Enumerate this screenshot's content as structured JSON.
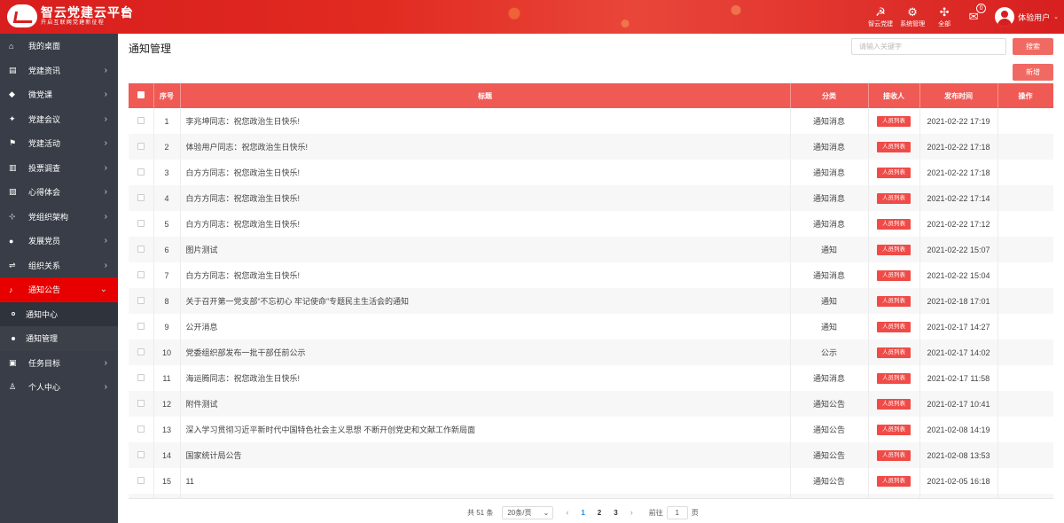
{
  "app": {
    "title": "智云党建云平台",
    "subtitle": "开启互联网党建新征程",
    "menu_toggle": "☰"
  },
  "header": {
    "tools": [
      {
        "icon": "party-icon",
        "glyph": "☭",
        "label": "智云党建"
      },
      {
        "icon": "gear-icon",
        "glyph": "⚙",
        "label": "系统管理"
      },
      {
        "icon": "grid-icon",
        "glyph": "✣",
        "label": "全部"
      }
    ],
    "mail_count": "0",
    "user_name": "体验用户",
    "user_caret": "⌄"
  },
  "sidebar": {
    "items": [
      {
        "icon": "home-icon",
        "glyph": "⌂",
        "label": "我的桌面",
        "chevron": ""
      },
      {
        "icon": "news-icon",
        "glyph": "▤",
        "label": "党建资讯",
        "chevron": "›"
      },
      {
        "icon": "course-icon",
        "glyph": "◆",
        "label": "微党课",
        "chevron": "›"
      },
      {
        "icon": "meeting-icon",
        "glyph": "✦",
        "label": "党建会议",
        "chevron": "›"
      },
      {
        "icon": "flag-icon",
        "glyph": "⚑",
        "label": "党建活动",
        "chevron": "›"
      },
      {
        "icon": "chart-icon",
        "glyph": "▥",
        "label": "投票调查",
        "chevron": "›"
      },
      {
        "icon": "notes-icon",
        "glyph": "▧",
        "label": "心得体会",
        "chevron": "›"
      },
      {
        "icon": "org-icon",
        "glyph": "⊹",
        "label": "党组织架构",
        "chevron": "›"
      },
      {
        "icon": "member-icon",
        "glyph": "●",
        "label": "发展党员",
        "chevron": "›"
      },
      {
        "icon": "transfer-icon",
        "glyph": "⇌",
        "label": "组织关系",
        "chevron": "›"
      },
      {
        "icon": "bell-icon",
        "glyph": "♪",
        "label": "通知公告",
        "chevron": "⌄"
      },
      {
        "icon": "",
        "glyph": "",
        "label": "通知中心",
        "chevron": ""
      },
      {
        "icon": "",
        "glyph": "",
        "label": "通知管理",
        "chevron": ""
      },
      {
        "icon": "task-icon",
        "glyph": "▣",
        "label": "任务目标",
        "chevron": "›"
      },
      {
        "icon": "person-icon",
        "glyph": "♙",
        "label": "个人中心",
        "chevron": "›"
      }
    ]
  },
  "main": {
    "title": "通知管理",
    "search_placeholder": "请输入关键字",
    "search_label": "搜索",
    "add_label": "新增"
  },
  "table": {
    "headers": {
      "index": "序号",
      "title": "标题",
      "category": "分类",
      "receiver": "接收人",
      "time": "发布时间",
      "action": "操作"
    },
    "rows": [
      {
        "index": "1",
        "title": "李兆坤同志：祝您政治生日快乐!",
        "category": "通知消息",
        "receiver": "人员列表",
        "time": "2021-02-22 17:19"
      },
      {
        "index": "2",
        "title": "体验用户同志：祝您政治生日快乐!",
        "category": "通知消息",
        "receiver": "人员列表",
        "time": "2021-02-22 17:18"
      },
      {
        "index": "3",
        "title": "白方方同志：祝您政治生日快乐!",
        "category": "通知消息",
        "receiver": "人员列表",
        "time": "2021-02-22 17:18"
      },
      {
        "index": "4",
        "title": "白方方同志：祝您政治生日快乐!",
        "category": "通知消息",
        "receiver": "人员列表",
        "time": "2021-02-22 17:14"
      },
      {
        "index": "5",
        "title": "白方方同志：祝您政治生日快乐!",
        "category": "通知消息",
        "receiver": "人员列表",
        "time": "2021-02-22 17:12"
      },
      {
        "index": "6",
        "title": "图片测试",
        "category": "通知",
        "receiver": "人员列表",
        "time": "2021-02-22 15:07"
      },
      {
        "index": "7",
        "title": "白方方同志：祝您政治生日快乐!",
        "category": "通知消息",
        "receiver": "人员列表",
        "time": "2021-02-22 15:04"
      },
      {
        "index": "8",
        "title": "关于召开第一党支部“不忘初心 牢记使命”专题民主生活会的通知",
        "category": "通知",
        "receiver": "人员列表",
        "time": "2021-02-18 17:01"
      },
      {
        "index": "9",
        "title": "公开消息",
        "category": "通知",
        "receiver": "人员列表",
        "time": "2021-02-17 14:27"
      },
      {
        "index": "10",
        "title": "党委组织部发布一批干部任前公示",
        "category": "公示",
        "receiver": "人员列表",
        "time": "2021-02-17 14:02"
      },
      {
        "index": "11",
        "title": "海运腾同志：祝您政治生日快乐!",
        "category": "通知消息",
        "receiver": "人员列表",
        "time": "2021-02-17 11:58"
      },
      {
        "index": "12",
        "title": "附件测试",
        "category": "通知公告",
        "receiver": "人员列表",
        "time": "2021-02-17 10:41"
      },
      {
        "index": "13",
        "title": "深入学习贯彻习近平新时代中国特色社会主义思想 不断开创党史和文献工作新局面",
        "category": "通知公告",
        "receiver": "人员列表",
        "time": "2021-02-08 14:19"
      },
      {
        "index": "14",
        "title": "国家统计局公告",
        "category": "通知公告",
        "receiver": "人员列表",
        "time": "2021-02-08 13:53"
      },
      {
        "index": "15",
        "title": "11",
        "category": "通知公告",
        "receiver": "人员列表",
        "time": "2021-02-05 16:18"
      },
      {
        "index": "16",
        "title": "",
        "category": "",
        "receiver": "",
        "time": ""
      }
    ]
  },
  "pagination": {
    "total": "共 51 条",
    "page_size": "20条/页",
    "prev": "‹",
    "next": "›",
    "pages": [
      "1",
      "2",
      "3"
    ],
    "current": "1",
    "goto_label": "前往",
    "goto_value": "1",
    "page_unit": "页"
  },
  "colors": {
    "header_red": "#d81e1e",
    "sidebar_bg": "#383d47",
    "active_red": "#e60000",
    "table_head": "#ef5a55",
    "tag_red": "#f04b47"
  }
}
